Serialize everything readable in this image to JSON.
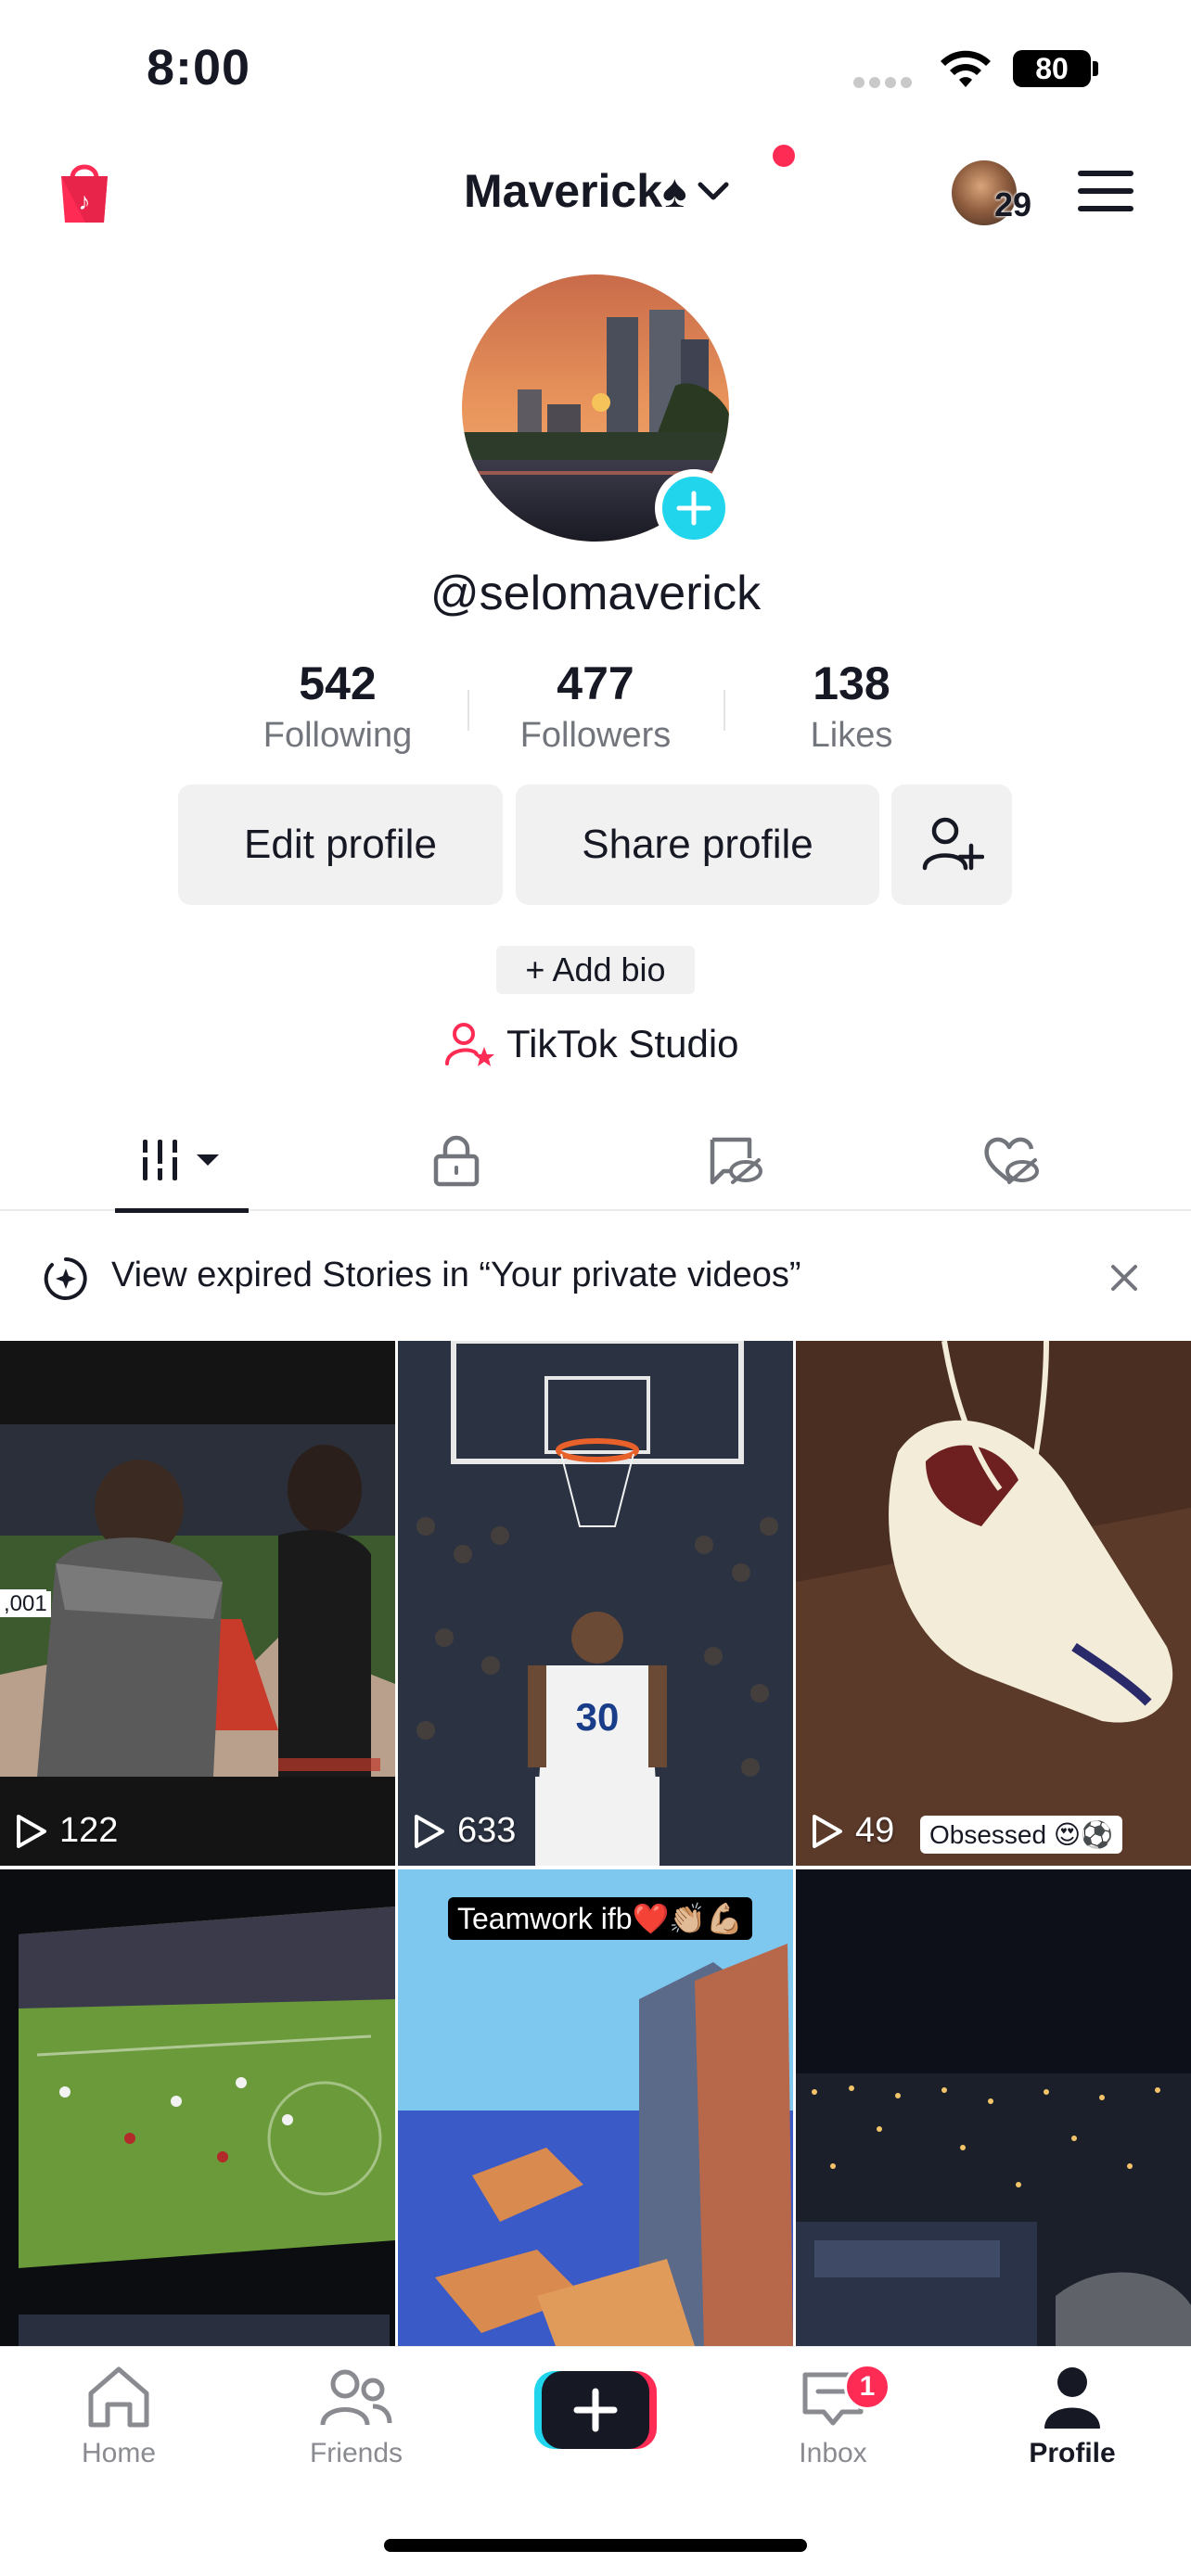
{
  "status_bar": {
    "time": "8:00",
    "battery": "80"
  },
  "header": {
    "account_name": "Maverick♠",
    "mini_avatar_count": "29"
  },
  "profile": {
    "username": "@selomaverick",
    "stats": [
      {
        "value": "542",
        "label": "Following"
      },
      {
        "value": "477",
        "label": "Followers"
      },
      {
        "value": "138",
        "label": "Likes"
      }
    ],
    "buttons": {
      "edit": "Edit profile",
      "share": "Share profile"
    },
    "add_bio": "+ Add bio",
    "studio": "TikTok Studio"
  },
  "tabs": [
    "videos-tab",
    "private-tab",
    "reposts-tab",
    "liked-tab"
  ],
  "banner": {
    "text": "View expired Stories in “Your private videos”"
  },
  "videos": [
    {
      "views": "122",
      "caption": "",
      "overlay_text": ",001"
    },
    {
      "views": "633",
      "caption": ""
    },
    {
      "views": "49",
      "caption": "Obsessed 😍⚽"
    },
    {
      "views": "",
      "caption": ""
    },
    {
      "views": "",
      "caption": "Teamwork ifb❤️👏🏼💪🏼"
    },
    {
      "views": "",
      "caption": ""
    }
  ],
  "bottom_nav": {
    "home": "Home",
    "friends": "Friends",
    "inbox": "Inbox",
    "inbox_badge": "1",
    "profile": "Profile"
  },
  "colors": {
    "brand_red": "#fe2c55",
    "brand_cyan": "#20d5ec",
    "text": "#161823",
    "muted": "#73757c"
  }
}
